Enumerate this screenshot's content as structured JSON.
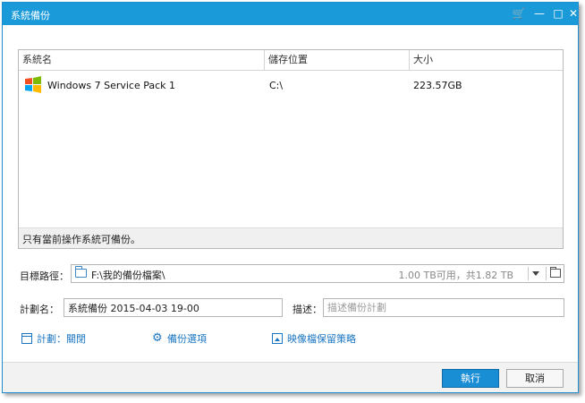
{
  "window": {
    "title": "系統備份",
    "colors": {
      "accent": "#1a9ad9",
      "link": "#1a75c2",
      "primary_button": "#1a8ed4"
    }
  },
  "table": {
    "columns": [
      "系統名",
      "儲存位置",
      "大小"
    ],
    "rows": [
      {
        "icon": "windows-logo-icon",
        "name": "Windows 7 Service Pack 1",
        "location": "C:\\",
        "size": "223.57GB"
      }
    ],
    "footer_note": "只有當前操作系統可備份。"
  },
  "target": {
    "label": "目標路徑：",
    "path": "F:\\我的備份檔案\\",
    "space": "1.00 TB可用，共1.82 TB"
  },
  "plan": {
    "label": "計劃名：",
    "value": "系統備份 2015-04-03 19-00"
  },
  "description": {
    "label": "描述：",
    "placeholder": "描述備份計劃"
  },
  "links": {
    "schedule": "計劃：關閉",
    "backup_options": "備份選項",
    "image_retention": "映像檔保留策略"
  },
  "buttons": {
    "run": "執行",
    "cancel": "取消"
  }
}
